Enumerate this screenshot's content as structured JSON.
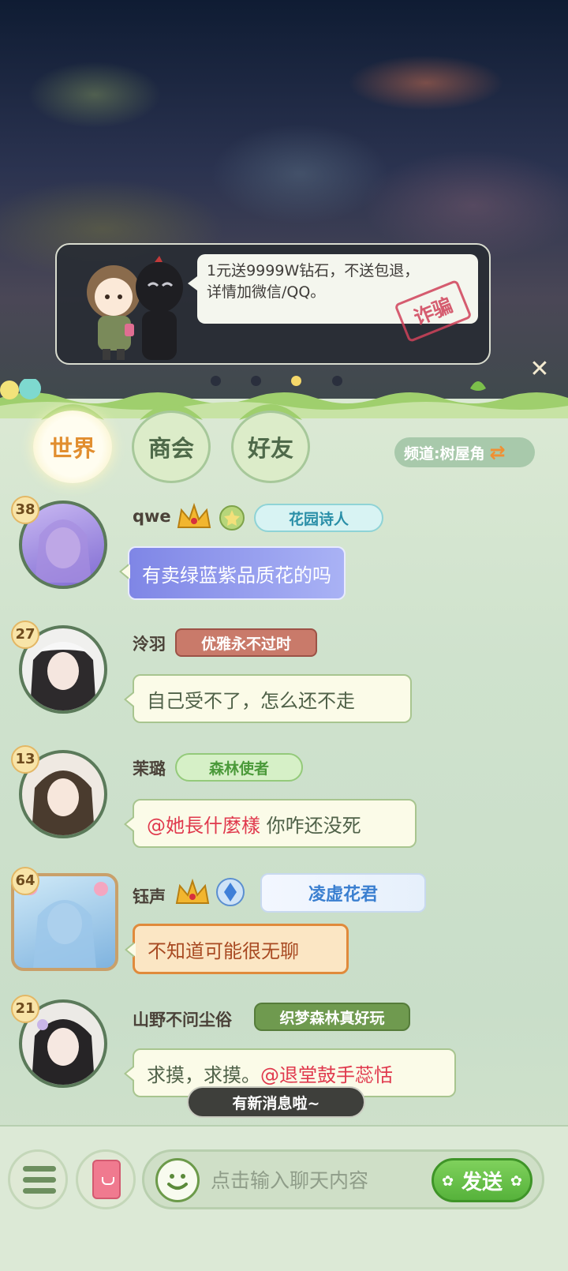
{
  "banner": {
    "text_line1": "1元送9999W钻石，不送包退，",
    "text_line2": "详情加微信/QQ。",
    "stamp": "诈骗",
    "dots_total": 4,
    "dots_active_index": 2
  },
  "tabs": [
    {
      "label": "世界",
      "active": true
    },
    {
      "label": "商会",
      "active": false
    },
    {
      "label": "好友",
      "active": false
    }
  ],
  "channel": {
    "label": "频道:树屋角"
  },
  "messages": [
    {
      "level": "38",
      "name": "qwe",
      "title": "花园诗人",
      "text": "有卖绿蓝紫品质花的吗"
    },
    {
      "level": "27",
      "name": "泠羽",
      "title": "优雅永不过时",
      "text": "自己受不了，怎么还不走"
    },
    {
      "level": "13",
      "name": "茉璐",
      "title": "森林使者",
      "mention": "@她長什麼樣",
      "text": " 你咋还没死"
    },
    {
      "level": "64",
      "name": "钰声",
      "title": "凌虚花君",
      "text": "不知道可能很无聊"
    },
    {
      "level": "21",
      "name": "山野不问尘俗",
      "title": "织梦森林真好玩",
      "text": "求摸，求摸。",
      "mention": "@退堂鼓手蕊恬"
    }
  ],
  "toast": "有新消息啦~",
  "input": {
    "placeholder": "点击输入聊天内容",
    "send_label": "发送"
  },
  "colors": {
    "accent_orange": "#e18e2f",
    "send_green": "#56b23b",
    "mention_red": "#e0394d"
  }
}
